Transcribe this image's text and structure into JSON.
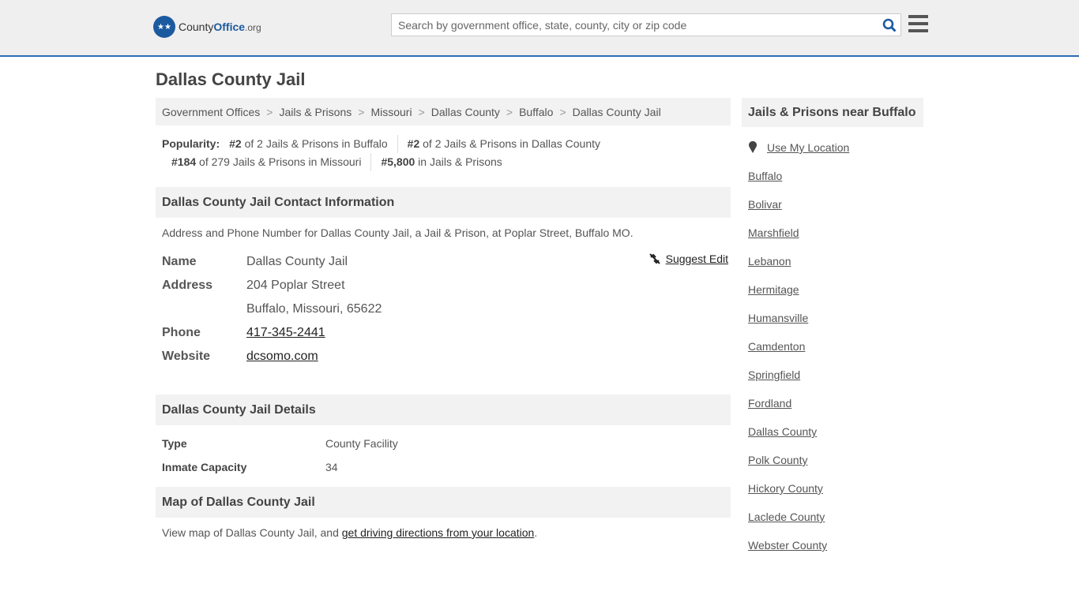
{
  "header": {
    "logo_text_a": "County",
    "logo_text_b": "Office",
    "logo_text_c": ".org",
    "search_placeholder": "Search by government office, state, county, city or zip code"
  },
  "page_title": "Dallas County Jail",
  "breadcrumb": [
    "Government Offices",
    "Jails & Prisons",
    "Missouri",
    "Dallas County",
    "Buffalo",
    "Dallas County Jail"
  ],
  "popularity": {
    "label": "Popularity:",
    "items": [
      {
        "rank": "#2",
        "text": " of 2 Jails & Prisons in Buffalo"
      },
      {
        "rank": "#2",
        "text": " of 2 Jails & Prisons in Dallas County"
      },
      {
        "rank": "#184",
        "text": " of 279 Jails & Prisons in Missouri"
      },
      {
        "rank": "#5,800",
        "text": " in Jails & Prisons"
      }
    ]
  },
  "contact": {
    "heading": "Dallas County Jail Contact Information",
    "description": "Address and Phone Number for Dallas County Jail, a Jail & Prison, at Poplar Street, Buffalo MO.",
    "suggest_edit": "Suggest Edit",
    "name_label": "Name",
    "name": "Dallas County Jail",
    "address_label": "Address",
    "address1": "204 Poplar Street",
    "address2": "Buffalo, Missouri, 65622",
    "phone_label": "Phone",
    "phone": "417-345-2441",
    "website_label": "Website",
    "website": "dcsomo.com"
  },
  "details": {
    "heading": "Dallas County Jail Details",
    "type_label": "Type",
    "type": "County Facility",
    "capacity_label": "Inmate Capacity",
    "capacity": "34"
  },
  "map": {
    "heading": "Map of Dallas County Jail",
    "text_a": "View map of Dallas County Jail, and ",
    "link": "get driving directions from your location",
    "text_b": "."
  },
  "sidebar": {
    "heading": "Jails & Prisons near Buffalo",
    "use_location": "Use My Location",
    "links": [
      "Buffalo",
      "Bolivar",
      "Marshfield",
      "Lebanon",
      "Hermitage",
      "Humansville",
      "Camdenton",
      "Springfield",
      "Fordland",
      "Dallas County",
      "Polk County",
      "Hickory County",
      "Laclede County",
      "Webster County"
    ]
  }
}
